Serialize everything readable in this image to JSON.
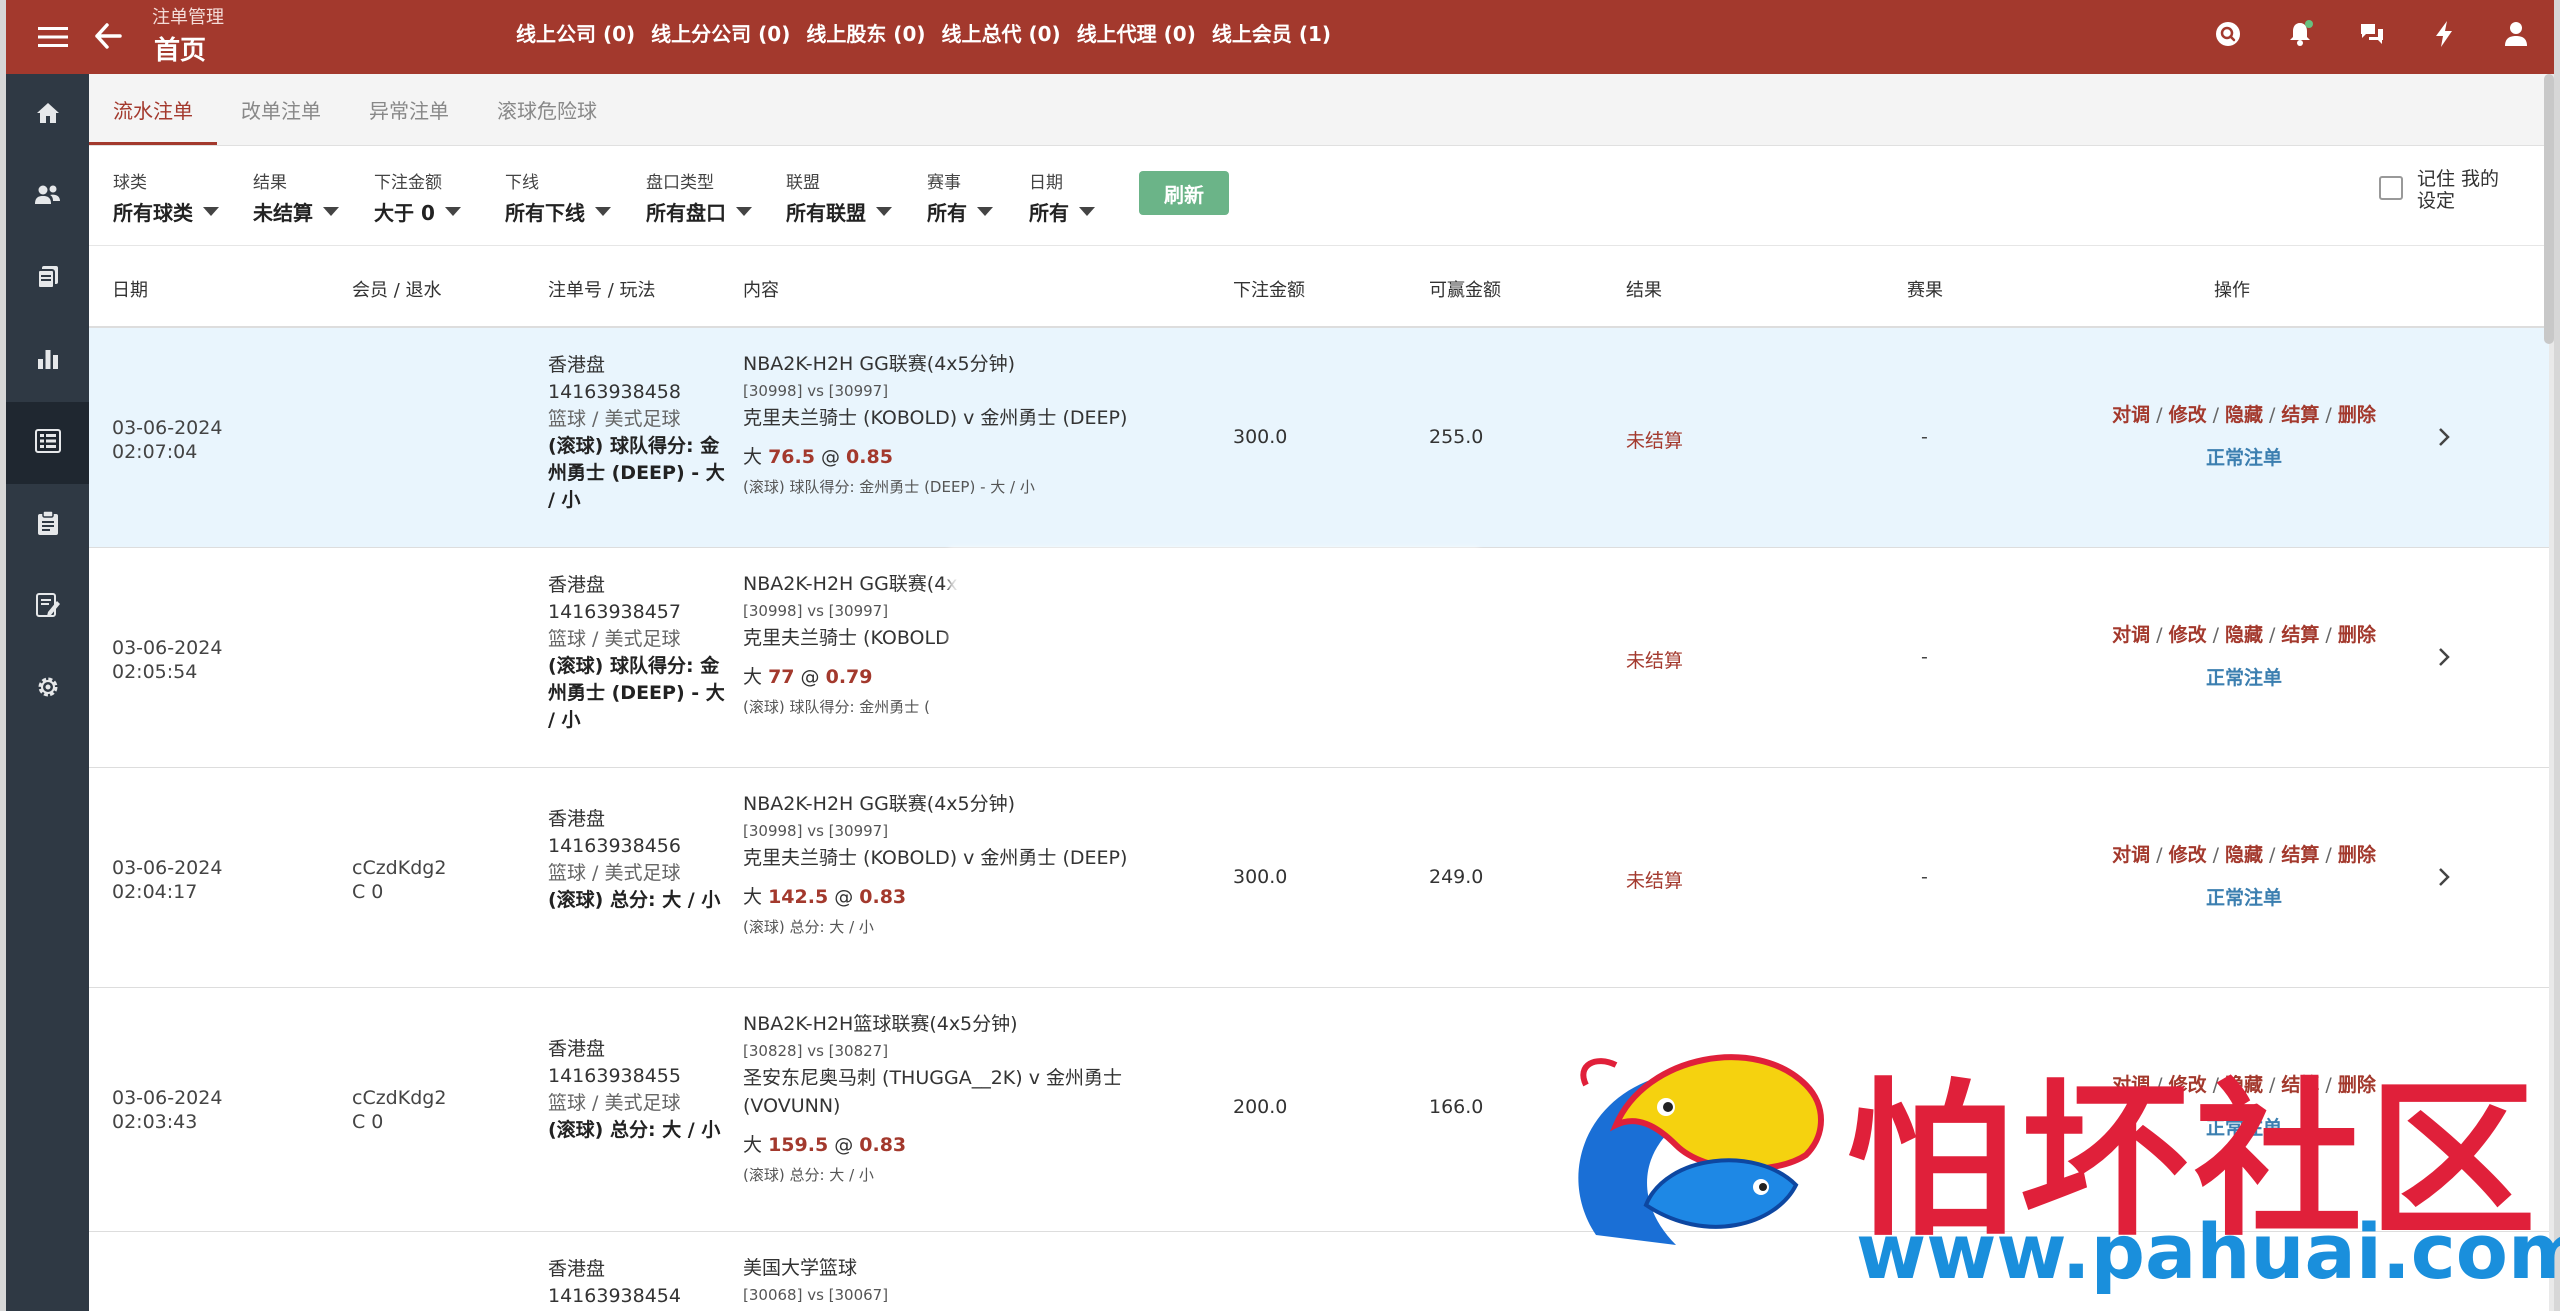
{
  "header": {
    "parent": "注单管理",
    "title": "首页",
    "links": [
      "线上公司 (0)",
      "线上分公司 (0)",
      "线上股东 (0)",
      "线上总代 (0)",
      "线上代理 (0)",
      "线上会员 (1)"
    ]
  },
  "tabs": [
    "流水注单",
    "改单注单",
    "异常注单",
    "滚球危险球"
  ],
  "filters": [
    {
      "label": "球类",
      "value": "所有球类"
    },
    {
      "label": "结果",
      "value": "未结算"
    },
    {
      "label": "下注金额",
      "value": "大于 0"
    },
    {
      "label": "下线",
      "value": "所有下线"
    },
    {
      "label": "盘口类型",
      "value": "所有盘口"
    },
    {
      "label": "联盟",
      "value": "所有联盟"
    },
    {
      "label": "赛事",
      "value": "所有"
    },
    {
      "label": "日期",
      "value": "所有"
    }
  ],
  "refresh_label": "刷新",
  "remember_label": "记住 我的设定",
  "columns": [
    "日期",
    "会员 / 退水",
    "注单号 / 玩法",
    "内容",
    "下注金额",
    "可赢金额",
    "结果",
    "赛果",
    "操作"
  ],
  "ops": {
    "actions": [
      "对调",
      "修改",
      "隐藏",
      "结算",
      "删除"
    ],
    "status": "正常注单"
  },
  "rows": [
    {
      "date": "03-06-2024",
      "time": "02:07:04",
      "member": "",
      "rebate": "",
      "market": "香港盘",
      "ticket": "14163938458",
      "sport": "篮球 / 美式足球",
      "play": "(滚球) 球队得分: 金州勇士 (DEEP) - 大 / 小",
      "league": "NBA2K-H2H GG联赛(4x5分钟)",
      "teams_id": "[30998] vs [30997]",
      "match": "克里夫兰骑士 (KOBOLD) v 金州勇士 (DEEP)",
      "side": "大",
      "line": "76.5",
      "odds": "0.85",
      "sub": "(滚球) 球队得分: 金州勇士 (DEEP) - 大 / 小",
      "amount": "300.0",
      "win": "255.0",
      "result": "未结算",
      "score": "-"
    },
    {
      "date": "03-06-2024",
      "time": "02:05:54",
      "member": "",
      "rebate": "",
      "market": "香港盘",
      "ticket": "14163938457",
      "sport": "篮球 / 美式足球",
      "play": "(滚球) 球队得分: 金州勇士 (DEEP) - 大 / 小",
      "league": "NBA2K-H2H GG联赛(4x",
      "teams_id": "[30998] vs [30997]",
      "match": "克里夫兰骑士 (KOBOLD",
      "side": "大",
      "line": "77",
      "odds": "0.79",
      "sub": "(滚球) 球队得分: 金州勇士 (",
      "amount": "",
      "win": "",
      "result": "未结算",
      "score": "-"
    },
    {
      "date": "03-06-2024",
      "time": "02:04:17",
      "member": "cCzdKdg2",
      "rebate": "C 0",
      "market": "香港盘",
      "ticket": "14163938456",
      "sport": "篮球 / 美式足球",
      "play": "(滚球) 总分: 大 / 小",
      "league": "NBA2K-H2H GG联赛(4x5分钟)",
      "teams_id": "[30998] vs [30997]",
      "match": "克里夫兰骑士 (KOBOLD) v 金州勇士 (DEEP)",
      "side": "大",
      "line": "142.5",
      "odds": "0.83",
      "sub": "(滚球) 总分: 大 / 小",
      "amount": "300.0",
      "win": "249.0",
      "result": "未结算",
      "score": "-"
    },
    {
      "date": "03-06-2024",
      "time": "02:03:43",
      "member": "cCzdKdg2",
      "rebate": "C 0",
      "market": "香港盘",
      "ticket": "14163938455",
      "sport": "篮球 / 美式足球",
      "play": "(滚球) 总分: 大 / 小",
      "league": "NBA2K-H2H篮球联赛(4x5分钟)",
      "teams_id": "[30828] vs [30827]",
      "match": "圣安东尼奥马刺 (THUGGA__2K) v 金州勇士 (VOVUNN)",
      "side": "大",
      "line": "159.5",
      "odds": "0.83",
      "sub": "(滚球) 总分: 大 / 小",
      "amount": "200.0",
      "win": "166.0",
      "result": "",
      "score": ""
    },
    {
      "date": "",
      "time": "",
      "member": "",
      "rebate": "",
      "market": "香港盘",
      "ticket": "14163938454",
      "sport": "",
      "play": "",
      "league": "美国大学篮球",
      "teams_id": "[30068] vs [30067]",
      "match": "",
      "side": "",
      "line": "",
      "odds": "",
      "sub": "",
      "amount": "",
      "win": "",
      "result": "",
      "score": ""
    }
  ],
  "watermark": {
    "text": "怕坏社区",
    "url": "www.pahuai.com"
  },
  "icons": {
    "top_left": [
      "menu-icon",
      "back-arrow-icon"
    ],
    "top_right": [
      "search-icon",
      "bell-icon",
      "chat-icon",
      "bolt-icon",
      "user-icon"
    ],
    "sidebar": [
      "home-icon",
      "users-icon",
      "documents-icon",
      "chart-icon",
      "list-icon",
      "clipboard-icon",
      "edit-doc-icon",
      "settings-icon"
    ]
  },
  "colors": {
    "brand": "#a3392d",
    "sidebar": "#2f3944",
    "refresh": "#6bb488",
    "status_link": "#3c7fb0",
    "highlight_row": "#e9f5fd"
  }
}
